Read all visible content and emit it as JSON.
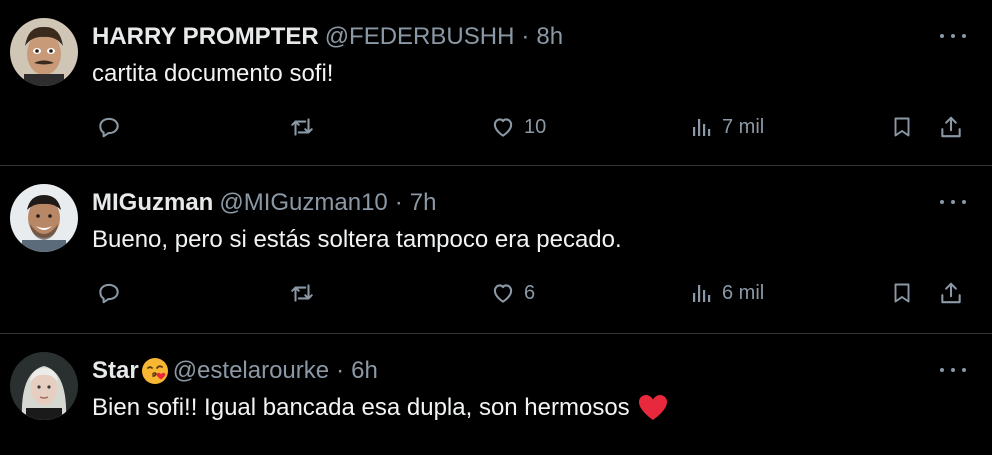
{
  "tweets": [
    {
      "display_name": "HARRY PROMPTER",
      "handle": "@FEDERBUSHH",
      "separator": "·",
      "time": "8h",
      "text": "cartita documento sofi!",
      "replies": "",
      "retweets": "",
      "likes": "10",
      "views": "7 mil"
    },
    {
      "display_name": "MIGuzman",
      "handle": "@MIGuzman10",
      "separator": "·",
      "time": "7h",
      "text": "Bueno, pero si estás soltera tampoco era pecado.",
      "replies": "",
      "retweets": "",
      "likes": "6",
      "views": "6 mil"
    },
    {
      "display_name": "Star",
      "handle": "@estelarourke",
      "separator": "·",
      "time": "6h",
      "text": "Bien sofi!! Igual bancada esa dupla, son hermosos",
      "emoji_in_name": "kissing-face-emoji",
      "emoji_in_text": "red-heart-emoji"
    }
  ],
  "icons": {
    "reply": "reply-icon",
    "retweet": "retweet-icon",
    "like": "heart-icon",
    "views": "views-icon",
    "bookmark": "bookmark-icon",
    "share": "share-icon",
    "more": "more-icon"
  },
  "colors": {
    "background": "#000000",
    "primary_text": "#e7e9ea",
    "secondary_text": "#8b98a5",
    "divider": "#2f3336",
    "heart_red": "#f91880"
  }
}
